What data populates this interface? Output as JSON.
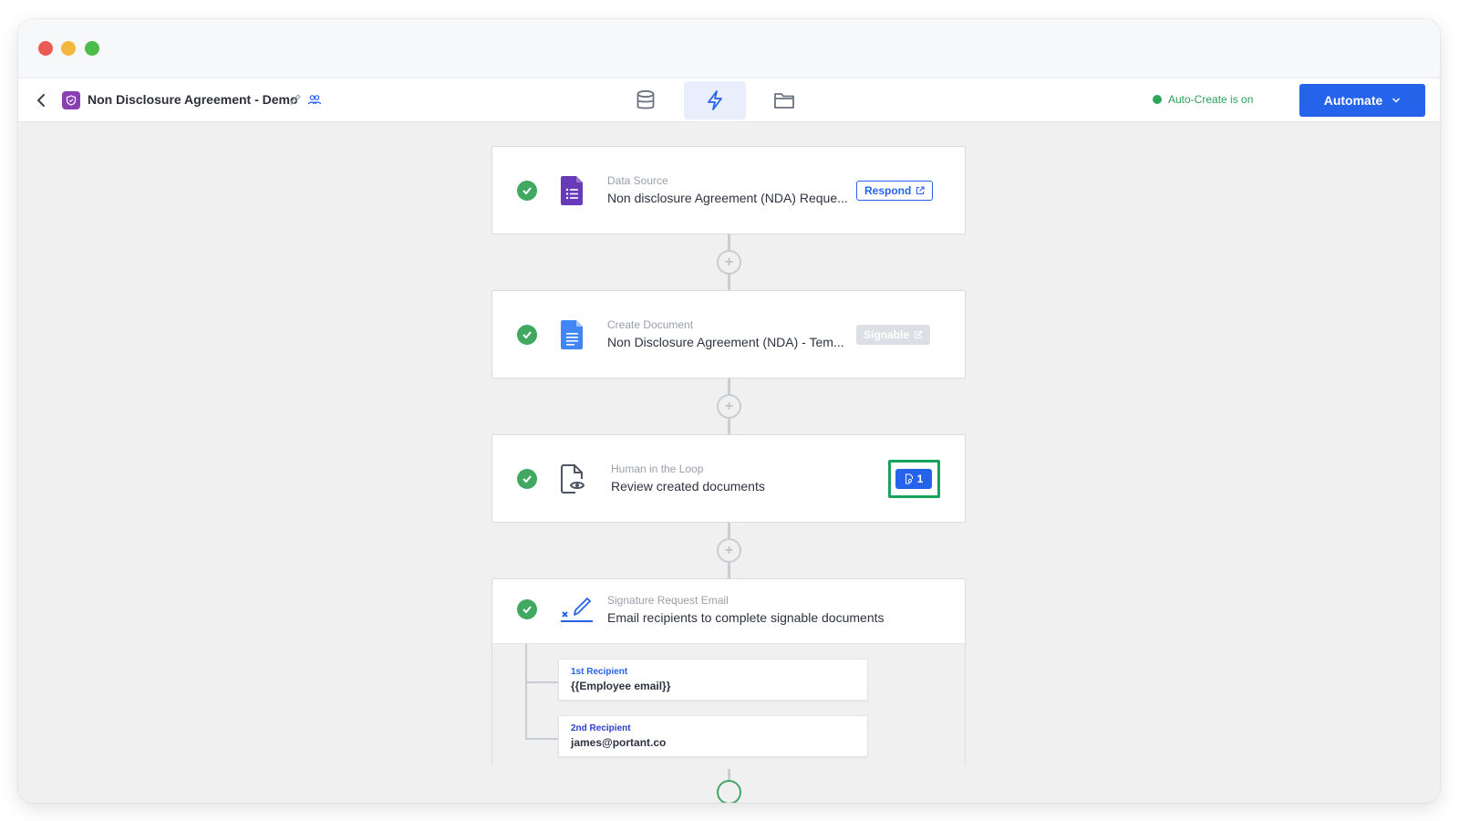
{
  "toolbar": {
    "title": "Non Disclosure Agreement - Demo",
    "auto_create_status": "Auto-Create is on",
    "automate_label": "Automate"
  },
  "nav_tabs": [
    {
      "icon": "database-icon",
      "active": false
    },
    {
      "icon": "lightning-icon",
      "active": true
    },
    {
      "icon": "folder-icon",
      "active": false
    }
  ],
  "steps": [
    {
      "kind": "Data Source",
      "name": "Non disclosure Agreement (NDA) Reque...",
      "chip": "Respond",
      "icon": "google-forms-icon"
    },
    {
      "kind": "Create Document",
      "name": "Non Disclosure Agreement (NDA) - Tem...",
      "chip": "Signable",
      "icon": "google-docs-icon"
    },
    {
      "kind": "Human in the Loop",
      "name": "Review created documents",
      "badge_count": "1",
      "icon": "document-review-icon"
    },
    {
      "kind": "Signature Request Email",
      "name": "Email recipients to complete signable documents",
      "icon": "signature-icon"
    }
  ],
  "recipients": [
    {
      "label": "1st Recipient",
      "value": "{{Employee email}}",
      "color": "#2563eb"
    },
    {
      "label": "2nd Recipient",
      "value": "james@portant.co",
      "color": "#2b3fc9"
    }
  ],
  "colors": {
    "accent": "#2563eb",
    "success": "#41a861",
    "forms_purple": "#673ab7",
    "docs_blue": "#4285f4",
    "highlight_green": "#17a35b"
  }
}
